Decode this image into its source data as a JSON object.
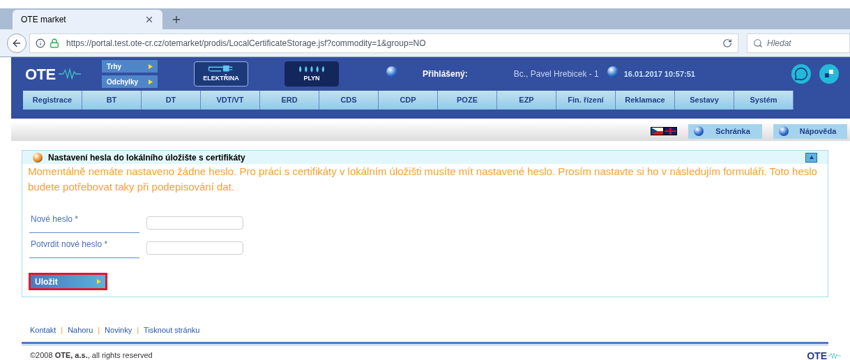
{
  "browser": {
    "tab_title": "OTE market",
    "url": "https://portal.test.ote-cr.cz/otemarket/prodis/LocalCertificateStorage.jsf?commodity=1&group=NO",
    "search_placeholder": "Hledat"
  },
  "header": {
    "logo": "OTE",
    "market_buttons": [
      {
        "label": "Trhy"
      },
      {
        "label": "Odchylky"
      }
    ],
    "commodities": [
      {
        "label": "ELEKTŘINA",
        "kind": "power",
        "selected": true
      },
      {
        "label": "PLYN",
        "kind": "gas",
        "selected": false
      }
    ],
    "logged_label": "Přihlášený:",
    "user": "Bc., Pavel Hrebicek - 1",
    "datetime": "16.01.2017 10:57:51"
  },
  "menu": [
    {
      "label": "Registrace"
    },
    {
      "label": "BT"
    },
    {
      "label": "DT"
    },
    {
      "label": "VDT/VT"
    },
    {
      "label": "ERD"
    },
    {
      "label": "CDS"
    },
    {
      "label": "CDP"
    },
    {
      "label": "POZE"
    },
    {
      "label": "EZP"
    },
    {
      "label": "Fin. řízení"
    },
    {
      "label": "Reklamace"
    },
    {
      "label": "Sestavy"
    },
    {
      "label": "Systém"
    }
  ],
  "toolbar": {
    "buttons": [
      {
        "label": "Schránka"
      },
      {
        "label": "Nápověda"
      }
    ]
  },
  "panel": {
    "title": "Nastavení hesla do lokálního úložište s certifikáty",
    "expanded": true,
    "message": "Momentálně nemáte nastaveno žádne heslo. Pro práci s certifikáty v lokálním úložišti musíte mít nastavené heslo. Prosím nastavte si ho v následujím formuláři. Toto heslo budete potřebovat taky při podepisování dat.",
    "fields": [
      {
        "label": "Nové heslo *"
      },
      {
        "label": "Potvrdit nové heslo *"
      }
    ],
    "save_button": "Uložit"
  },
  "footer": {
    "links": [
      {
        "label": "Kontakt"
      },
      {
        "label": "Nahoru"
      },
      {
        "label": "Novinky"
      },
      {
        "label": "Tisknout stránku"
      }
    ],
    "separator": "|",
    "copyright": "©2008 **OTE, a.s.**, all rights reserved",
    "logo": "OTE"
  }
}
